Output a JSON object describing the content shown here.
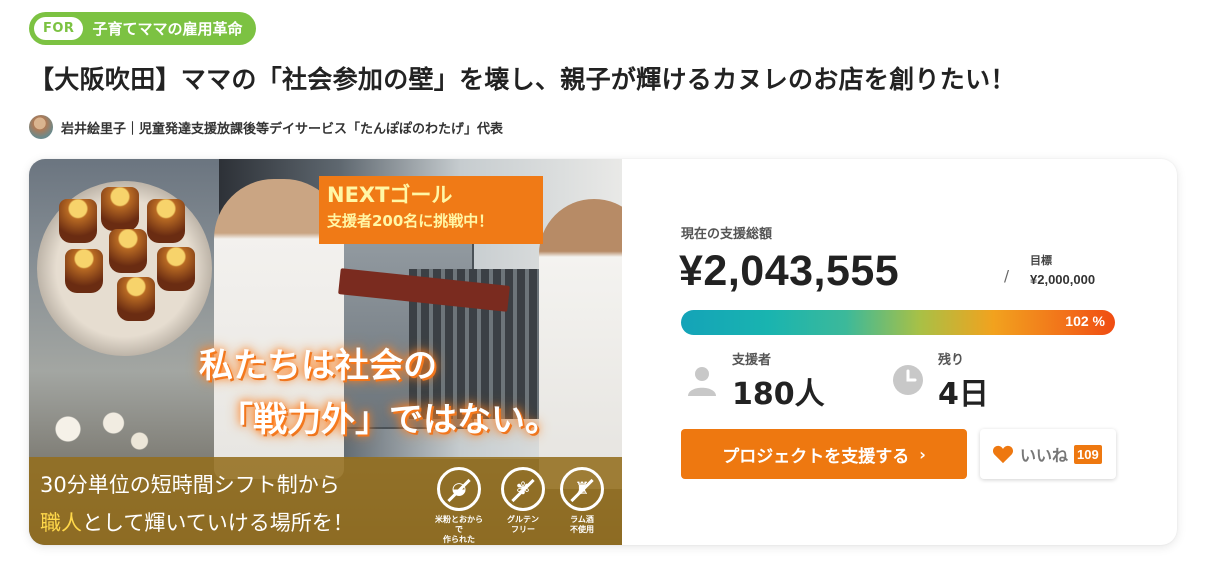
{
  "tag": {
    "prefix": "FOR",
    "label": "子育てママの雇用革命",
    "color": "#7cc242"
  },
  "project": {
    "title": "【大阪吹田】ママの「社会参加の壁」を壊し、親子が輝けるカヌレのお店を創りたい！",
    "owner": "岩井絵里子｜児童発達支援放課後等デイサービス「たんぽぽのわたげ」代表"
  },
  "hero": {
    "next_goal_title": "NEXTゴール",
    "next_goal_sub": "支援者200名に挑戦中！",
    "headline_line1": "私たちは社会の",
    "headline_line2": "「戦力外」ではない。",
    "band_line1": "30分単位の短時間シフト制から",
    "band_line2_highlight": "職人",
    "band_line2_rest": "として輝いていける場所を！",
    "badges": [
      {
        "icon": "rice-bowl-icon",
        "caption_l1": "米粉とおからで",
        "caption_l2": "作られた"
      },
      {
        "icon": "wheat-icon",
        "caption_l1": "グルテン",
        "caption_l2": "フリー"
      },
      {
        "icon": "bottle-icon",
        "caption_l1": "ラム酒",
        "caption_l2": "不使用"
      }
    ]
  },
  "funding": {
    "total_label": "現在の支援総額",
    "total_amount": "¥2,043,555",
    "slash": "/",
    "goal_label": "目標",
    "goal_amount": "¥2,000,000",
    "progress_percent": 102,
    "progress_label": "102 %",
    "supporters_label": "支援者",
    "supporters_value": "180人",
    "remaining_label": "残り",
    "remaining_value": "4日"
  },
  "actions": {
    "support_label": "プロジェクトを支援する",
    "support_chevron": "›",
    "like_label": "いいね",
    "like_count": "109"
  },
  "colors": {
    "accent": "#ee7810",
    "tag_green": "#7cc242"
  }
}
